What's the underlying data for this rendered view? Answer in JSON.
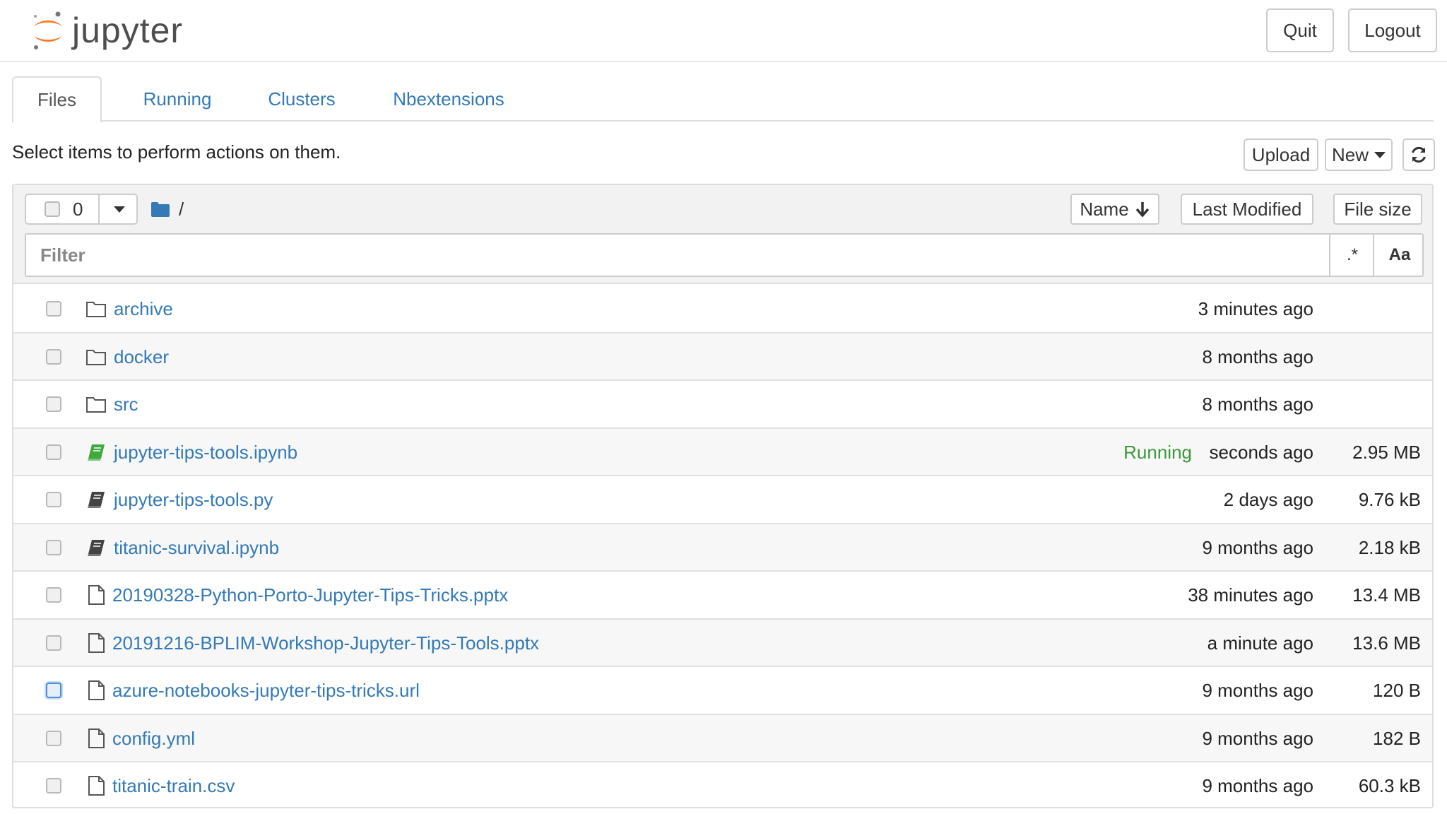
{
  "header": {
    "logo_text": "jupyter",
    "quit_label": "Quit",
    "logout_label": "Logout"
  },
  "tabs": [
    {
      "label": "Files",
      "active": true
    },
    {
      "label": "Running",
      "active": false
    },
    {
      "label": "Clusters",
      "active": false
    },
    {
      "label": "Nbextensions",
      "active": false
    }
  ],
  "toolbar": {
    "hint": "Select items to perform actions on them.",
    "upload_label": "Upload",
    "new_label": "New",
    "refresh_icon": "refresh-icon"
  },
  "list_header": {
    "selected_count": "0",
    "breadcrumb": "/",
    "sort_name_label": "Name",
    "sort_modified_label": "Last Modified",
    "sort_size_label": "File size",
    "filter_placeholder": "Filter",
    "regex_label": ".*",
    "case_label": "Aa"
  },
  "colors": {
    "link": "#337ab7",
    "running": "#3c9a3c",
    "notebook_running_icon": "#3fa93f",
    "logo_orange": "#f37726"
  },
  "files": [
    {
      "name": "archive",
      "type": "folder",
      "modified": "3 minutes ago",
      "size": "",
      "status": ""
    },
    {
      "name": "docker",
      "type": "folder",
      "modified": "8 months ago",
      "size": "",
      "status": ""
    },
    {
      "name": "src",
      "type": "folder",
      "modified": "8 months ago",
      "size": "",
      "status": ""
    },
    {
      "name": "jupyter-tips-tools.ipynb",
      "type": "notebook-running",
      "modified": "seconds ago",
      "size": "2.95 MB",
      "status": "Running"
    },
    {
      "name": "jupyter-tips-tools.py",
      "type": "notebook",
      "modified": "2 days ago",
      "size": "9.76 kB",
      "status": ""
    },
    {
      "name": "titanic-survival.ipynb",
      "type": "notebook",
      "modified": "9 months ago",
      "size": "2.18 kB",
      "status": ""
    },
    {
      "name": "20190328-Python-Porto-Jupyter-Tips-Tricks.pptx",
      "type": "file",
      "modified": "38 minutes ago",
      "size": "13.4 MB",
      "status": ""
    },
    {
      "name": "20191216-BPLIM-Workshop-Jupyter-Tips-Tools.pptx",
      "type": "file",
      "modified": "a minute ago",
      "size": "13.6 MB",
      "status": ""
    },
    {
      "name": "azure-notebooks-jupyter-tips-tricks.url",
      "type": "file",
      "modified": "9 months ago",
      "size": "120 B",
      "status": ""
    },
    {
      "name": "config.yml",
      "type": "file",
      "modified": "9 months ago",
      "size": "182 B",
      "status": ""
    },
    {
      "name": "titanic-train.csv",
      "type": "file",
      "modified": "9 months ago",
      "size": "60.3 kB",
      "status": ""
    }
  ]
}
